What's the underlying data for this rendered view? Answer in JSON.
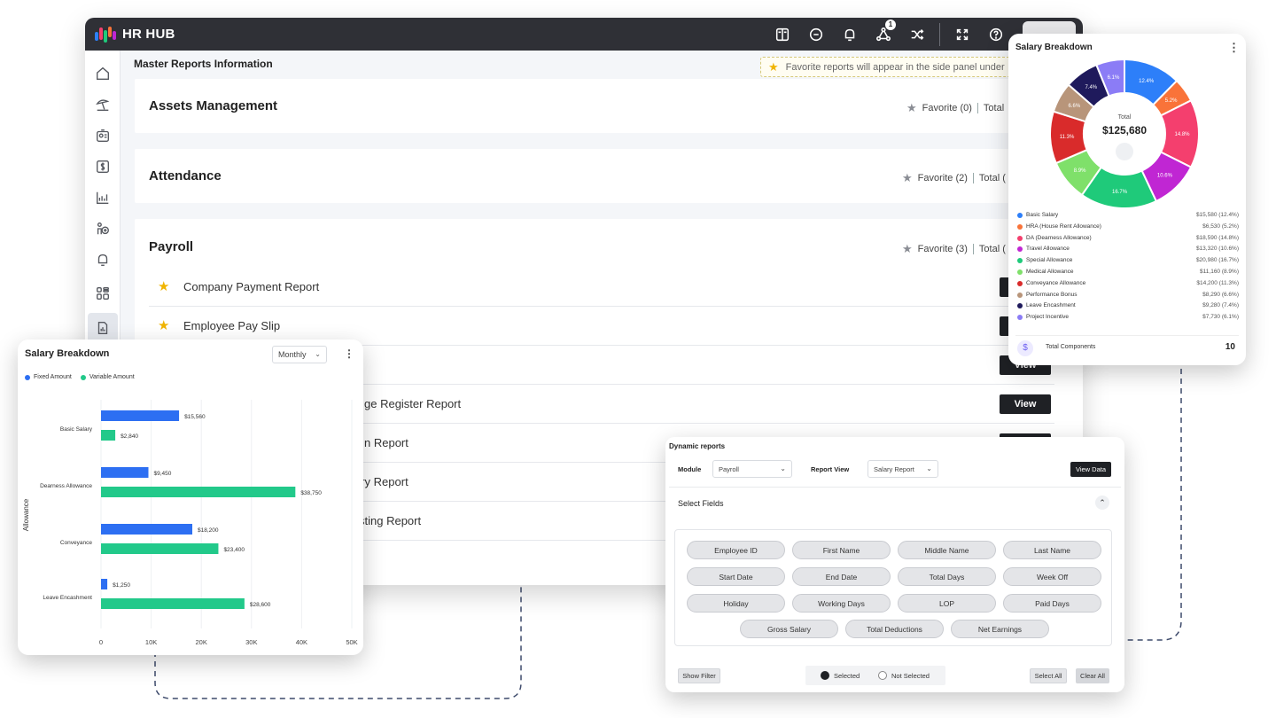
{
  "app": {
    "title": "HR HUB"
  },
  "topbar": {
    "icons": [
      "book-icon",
      "chat-icon",
      "bell-icon",
      "network-icon",
      "shuffle-icon",
      "expand-icon",
      "help-icon"
    ],
    "notification_count": "1"
  },
  "sidebar": {
    "items": [
      "home-icon",
      "beach-icon",
      "id-card-icon",
      "dollar-icon",
      "analytics-icon",
      "people-icon",
      "bell-icon",
      "apps-icon",
      "reports-icon"
    ]
  },
  "page": {
    "title": "Master Reports Information",
    "favorite_note": "Favorite reports will appear in the side panel under"
  },
  "sections": [
    {
      "title": "Assets Management",
      "favorite": "Favorite (0)",
      "total": "Total"
    },
    {
      "title": "Attendance",
      "favorite": "Favorite (2)",
      "total": "Total ("
    },
    {
      "title": "Payroll",
      "favorite": "Favorite (3)",
      "total": "Total ("
    }
  ],
  "payroll_reports": [
    {
      "name": "Company Payment Report",
      "favorite": true,
      "view": ""
    },
    {
      "name": "Employee Pay Slip",
      "favorite": true,
      "view": ""
    },
    {
      "name": "",
      "favorite": false,
      "view": "View"
    },
    {
      "name": "ge Register Report",
      "favorite": false,
      "view": "View"
    },
    {
      "name": "n Report",
      "favorite": false,
      "view": ""
    },
    {
      "name": "ary Report",
      "favorite": false,
      "view": ""
    },
    {
      "name": "sting Report",
      "favorite": false,
      "view": ""
    }
  ],
  "donut_card": {
    "title": "Salary Breakdown",
    "center_label": "Total",
    "center_value": "$125,680",
    "total_components_label": "Total Components",
    "total_components_value": "10",
    "colors": [
      "#2d7ff9",
      "#f97339",
      "#f43f6e",
      "#c026d3",
      "#1fca7a",
      "#7fe06a",
      "#d92b2b",
      "#b8957a",
      "#1f1a5c",
      "#8b7cf6"
    ]
  },
  "bar_card": {
    "title": "Salary Breakdown",
    "period": "Monthly",
    "legend_fixed": "Fixed Amount",
    "legend_variable": "Variable Amount",
    "colors": {
      "fixed": "#2d6ff2",
      "variable": "#22c98a"
    }
  },
  "dynamic_reports": {
    "title": "Dynamic reports",
    "module_label": "Module",
    "module_value": "Payroll",
    "report_view_label": "Report View",
    "report_view_value": "Salary Report",
    "view_data": "View Data",
    "select_fields": "Select Fields",
    "fields": [
      "Employee ID",
      "First Name",
      "Middle Name",
      "Last Name",
      "Start Date",
      "End Date",
      "Total Days",
      "Week Off",
      "Holiday",
      "Working Days",
      "LOP",
      "Paid Days",
      "Gross Salary",
      "Total Deductions",
      "Net Earnings"
    ],
    "show_filter": "Show Filter",
    "selected": "Selected",
    "not_selected": "Not Selected",
    "select_all": "Select All",
    "clear_all": "Clear All"
  },
  "chart_data": [
    {
      "type": "pie",
      "title": "Salary Breakdown",
      "total": "$125,680",
      "categories": [
        "Basic Salary",
        "HRA (House Rent Allowance)",
        "DA (Dearness Allowance)",
        "Travel Allowance",
        "Special Allowance",
        "Medical Allowance",
        "Conveyance Allowance",
        "Performance Bonus",
        "Leave Encashment",
        "Project Incentive"
      ],
      "values": [
        15580,
        6530,
        18590,
        13320,
        20980,
        11160,
        14200,
        8290,
        9280,
        7730
      ],
      "percent_labels": [
        "12.4%",
        "5.2%",
        "14.8%",
        "10.6%",
        "16.7%",
        "8.9%",
        "11.3%",
        "6.6%",
        "7.4%",
        "6.1%"
      ],
      "value_labels": [
        "$15,580 (12.4%)",
        "$6,530 (5.2%)",
        "$18,590 (14.8%)",
        "$13,320 (10.6%)",
        "$20,980 (16.7%)",
        "$11,160 (8.9%)",
        "$14,200 (11.3%)",
        "$8,290 (6.6%)",
        "$9,280 (7.4%)",
        "$7,730 (6.1%)"
      ],
      "legend_position": "bottom"
    },
    {
      "type": "bar",
      "orientation": "horizontal",
      "title": "Salary Breakdown",
      "categories": [
        "Basic Salary",
        "Dearness Allowance",
        "Conveyance",
        "Leave Encashment"
      ],
      "series": [
        {
          "name": "Fixed Amount",
          "values": [
            15560,
            9450,
            18200,
            1250
          ],
          "labels": [
            "$15,560",
            "$9,450",
            "$18,200",
            "$1,250"
          ]
        },
        {
          "name": "Variable Amount",
          "values": [
            2840,
            38750,
            23400,
            28600
          ],
          "labels": [
            "$2,840",
            "$38,750",
            "$23,400",
            "$28,600"
          ]
        }
      ],
      "ylabel": "Allowance",
      "xlim": [
        0,
        50000
      ],
      "xticks": [
        "0",
        "10K",
        "20K",
        "30K",
        "40K",
        "50K"
      ],
      "grid": true,
      "legend_position": "top-left"
    }
  ]
}
